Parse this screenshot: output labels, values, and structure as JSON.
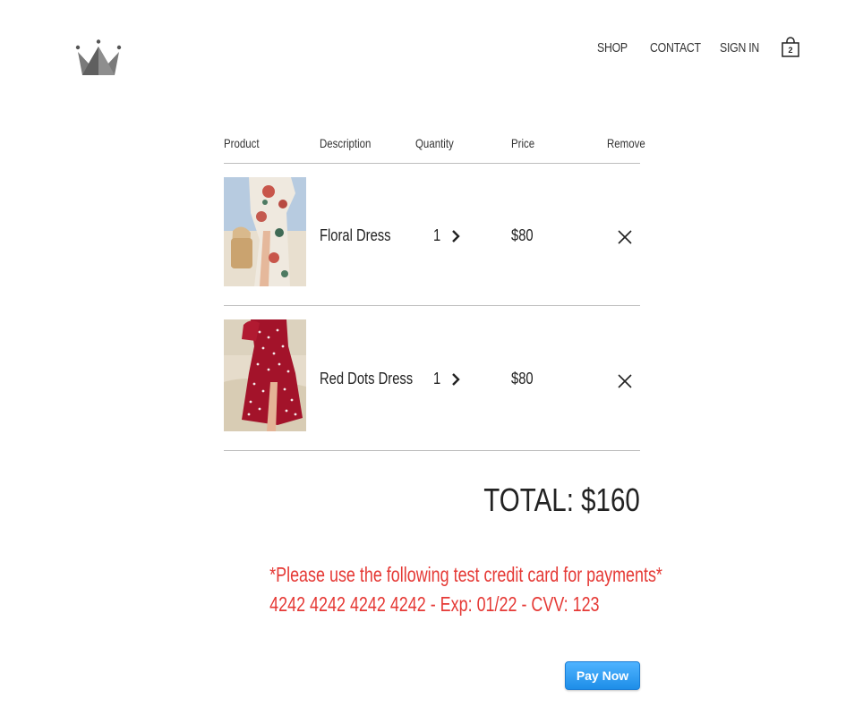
{
  "nav": {
    "shop": "SHOP",
    "contact": "CONTACT",
    "sign_in": "SIGN IN",
    "cart_count": "2"
  },
  "table": {
    "headers": {
      "product": "Product",
      "description": "Description",
      "quantity": "Quantity",
      "price": "Price",
      "remove": "Remove"
    },
    "items": [
      {
        "description": "Floral Dress",
        "quantity": "1",
        "price": "$80"
      },
      {
        "description": "Red Dots Dress",
        "quantity": "1",
        "price": "$80"
      }
    ]
  },
  "total": "TOTAL: $160",
  "notice": {
    "line1": "*Please use the following test credit card for payments*",
    "line2": "4242 4242 4242 4242 - Exp: 01/22 - CVV: 123"
  },
  "pay_button": "Pay Now",
  "colors": {
    "notice": "#e53935",
    "pay_button": "#1e8ee8",
    "logo": "#6d6d6d"
  },
  "icons": {
    "logo": "crown-icon",
    "cart": "shopping-bag-icon",
    "increase": "chevron-right-icon",
    "remove": "close-icon"
  }
}
